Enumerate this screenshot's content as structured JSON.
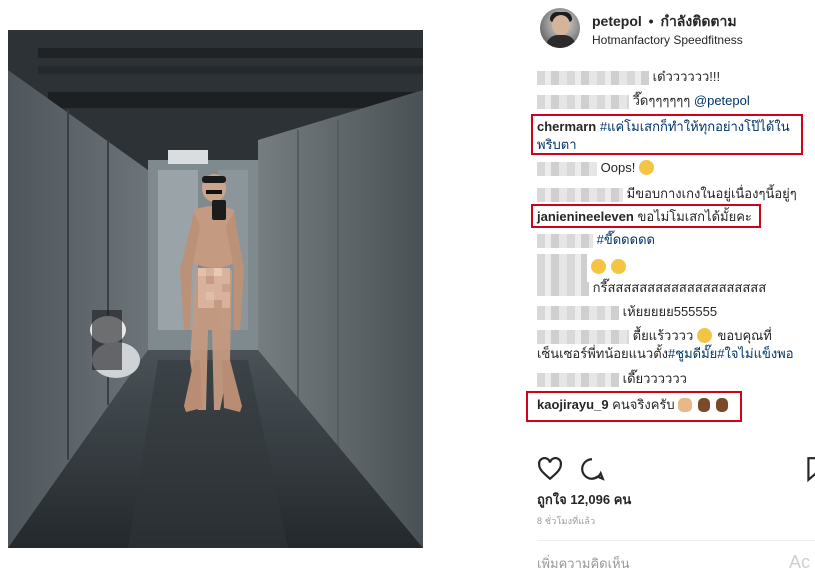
{
  "header": {
    "username": "petepol",
    "separator": "•",
    "follow_label": "กำลังติดตาม",
    "location": "Hotmanfactory Speedfitness"
  },
  "comments": [
    {
      "user": "",
      "text": "เด๋วววววว!!!"
    },
    {
      "user": "",
      "text": "วี๊ดๆๆๆๆๆๆ",
      "mention": "@petepol"
    },
    {
      "user": "chermarn",
      "text": "#แค่โมเสกก็ทำให้ทุกอย่างโป๊ได้ในพริบตา",
      "text_line1": "#แค่โมเสกก็ทำให้ทุกอย่างโป๊ได้ใน",
      "text_line2": "พริบตา"
    },
    {
      "user": "",
      "text": "Oops!"
    },
    {
      "user": "",
      "text": "มีขอบกางเกงในอยู่เนื่องๆนี้อยู่ๆ"
    },
    {
      "user": "janienineeleven",
      "text": "ขอไม่โมเสกได้มั้ยคะ"
    },
    {
      "user": "",
      "text": "#ขี๊ดดดดด"
    },
    {
      "user": "",
      "text": ""
    },
    {
      "user": "",
      "text": "กรี๊สสสสสสสสสสสสสสสสสสสส"
    },
    {
      "user": "",
      "text": "เห้ยยยยย555555"
    },
    {
      "user": "",
      "text": "ตื้ยแร้วววว",
      "text2": "ขอบคุณที่",
      "text3": "เซ็นเซอร์พี่ทน้อยแนวตั้ง",
      "tags": "#ชูมดีมั๊ย#ใจไม่แข็งพอ"
    },
    {
      "user": "",
      "text": "เดี๊ยวววววว"
    },
    {
      "user": "kaojirayu_9",
      "text": "คนจริงครับ"
    }
  ],
  "actions": {
    "like_icon": "heart-icon",
    "comment_icon": "comment-icon",
    "save_icon": "bookmark-icon"
  },
  "likes_label": "ถูกใจ 12,096 คน",
  "time_label": "8 ชั่วโมงที่แล้ว",
  "add_comment_placeholder": "เพิ่มความคิดเห็น",
  "watermark": "Ac",
  "colors": {
    "highlight": "#d0021b",
    "link": "#003569",
    "muted": "#999999"
  }
}
